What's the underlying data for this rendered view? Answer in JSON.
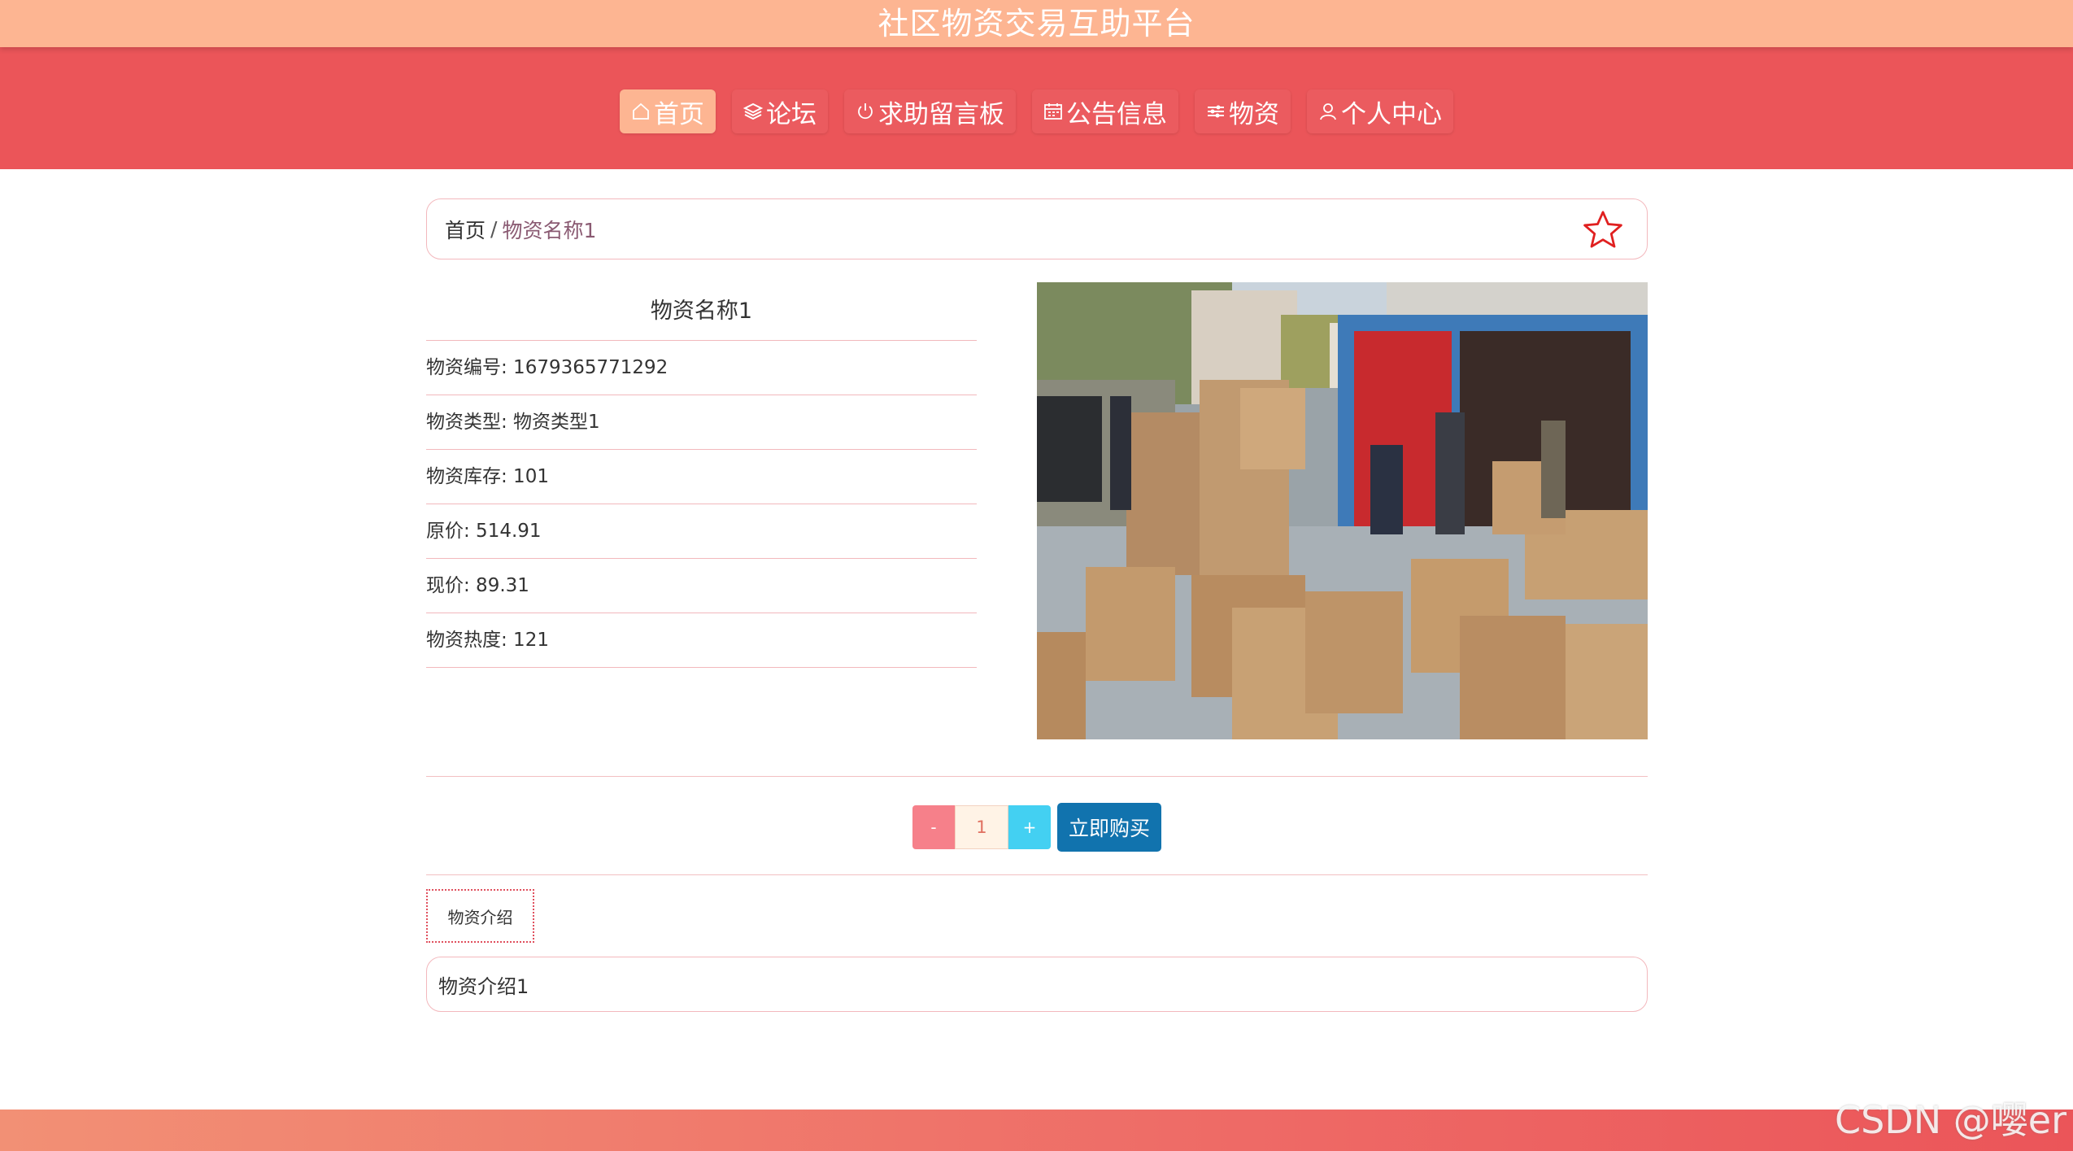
{
  "header": {
    "title": "社区物资交易互助平台"
  },
  "nav": {
    "items": [
      {
        "label": "首页",
        "icon": "home-icon",
        "active": true
      },
      {
        "label": "论坛",
        "icon": "layers-icon",
        "active": false
      },
      {
        "label": "求助留言板",
        "icon": "power-icon",
        "active": false
      },
      {
        "label": "公告信息",
        "icon": "calendar-icon",
        "active": false
      },
      {
        "label": "物资",
        "icon": "sliders-icon",
        "active": false
      },
      {
        "label": "个人中心",
        "icon": "user-icon",
        "active": false
      }
    ]
  },
  "breadcrumb": {
    "home": "首页",
    "separator": "/",
    "current": "物资名称1"
  },
  "favorite_icon": "star-outline-icon",
  "product": {
    "name": "物资名称1",
    "fields": [
      {
        "label": "物资编号: 1679365771292"
      },
      {
        "label": "物资类型: 物资类型1"
      },
      {
        "label": "物资库存: 101"
      },
      {
        "label": "原价: 514.91"
      },
      {
        "label": "现价: 89.31"
      },
      {
        "label": "物资热度: 121"
      }
    ],
    "image_alt": "cardboard boxes photo"
  },
  "purchase": {
    "minus": "-",
    "quantity": "1",
    "plus": "+",
    "buy_label": "立即购买"
  },
  "tabs": {
    "intro": "物资介绍"
  },
  "intro": {
    "text": "物资介绍1"
  },
  "watermark": "CSDN @嘤er",
  "colors": {
    "title_bar": "#fdb592",
    "nav_bar": "#eb5559",
    "buy_button": "#1173ae",
    "minus_button": "#f6808a",
    "plus_button": "#43d0f2",
    "star": "#e02020"
  }
}
